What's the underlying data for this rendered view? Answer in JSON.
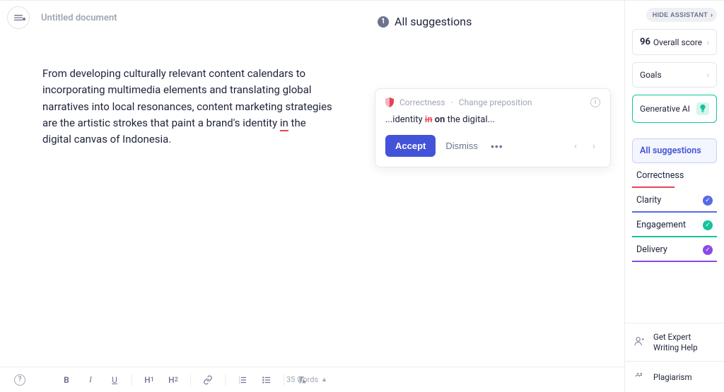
{
  "doc": {
    "title": "Untitled document"
  },
  "suggestions_header": {
    "count": "1",
    "label": "All suggestions"
  },
  "editor_text": {
    "prefix": "From developing culturally relevant content calendars to incorporating multimedia elements and translating global narratives into local resonances, content marketing strategies are the artistic strokes that paint a brand's identity ",
    "wrong": "in",
    "suffix": " the digital canvas of Indonesia."
  },
  "card": {
    "category": "Correctness",
    "sep": " · ",
    "rule": "Change preposition",
    "diff_before": "...identity ",
    "strike": "in",
    "space": " ",
    "replacement": "on",
    "diff_after": " the digital...",
    "accept": "Accept",
    "dismiss": "Dismiss",
    "more": "•••"
  },
  "toolbar": {
    "bold": "B",
    "italic": "I",
    "underline": "U",
    "h1": "H1",
    "h2": "H2",
    "word_count": "35 words"
  },
  "assistant": {
    "hide_label": "HIDE ASSISTANT",
    "score_num": "96",
    "score_label": "Overall score",
    "goals": "Goals",
    "gen_ai": "Generative AI"
  },
  "cats": {
    "all": "All suggestions",
    "correctness": "Correctness",
    "clarity": "Clarity",
    "engagement": "Engagement",
    "delivery": "Delivery"
  },
  "bottom_links": {
    "expert1": "Get Expert",
    "expert2": "Writing Help",
    "plagiarism": "Plagiarism"
  }
}
